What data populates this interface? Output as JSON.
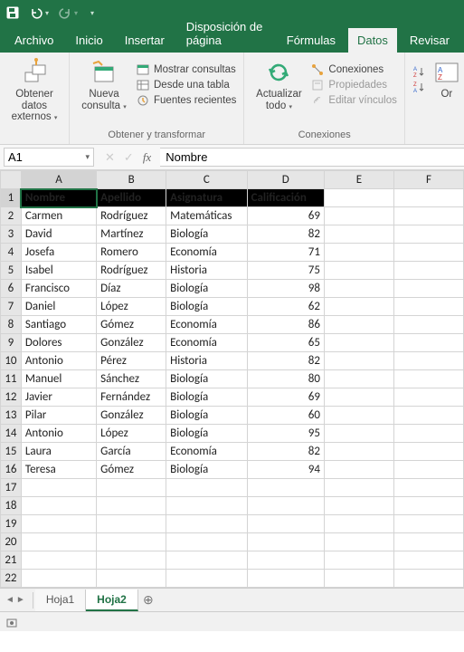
{
  "qat": {
    "save": "save-icon",
    "undo": "undo-icon",
    "redo": "redo-icon"
  },
  "menu_tabs": [
    "Archivo",
    "Inicio",
    "Insertar",
    "Disposición de página",
    "Fórmulas",
    "Datos",
    "Revisar"
  ],
  "active_menu_tab": "Datos",
  "ribbon": {
    "group1": {
      "btn_label_line1": "Obtener datos",
      "btn_label_line2": "externos",
      "label": ""
    },
    "group2": {
      "btn_label_line1": "Nueva",
      "btn_label_line2": "consulta",
      "items": [
        "Mostrar consultas",
        "Desde una tabla",
        "Fuentes recientes"
      ],
      "label": "Obtener y transformar"
    },
    "group3": {
      "btn_label_line1": "Actualizar",
      "btn_label_line2": "todo",
      "items": [
        "Conexiones",
        "Propiedades",
        "Editar vínculos"
      ],
      "label": "Conexiones"
    }
  },
  "namebox_value": "A1",
  "formula_value": "Nombre",
  "columns": [
    "A",
    "B",
    "C",
    "D",
    "E",
    "F"
  ],
  "row_count": 22,
  "headers": [
    "Nombre",
    "Apellido",
    "Asignatura",
    "Calificación"
  ],
  "rows": [
    [
      "Carmen",
      "Rodríguez",
      "Matemáticas",
      69
    ],
    [
      "David",
      "Martínez",
      "Biología",
      82
    ],
    [
      "Josefa",
      "Romero",
      "Economía",
      71
    ],
    [
      "Isabel",
      "Rodríguez",
      "Historia",
      75
    ],
    [
      "Francisco",
      "Díaz",
      "Biología",
      98
    ],
    [
      "Daniel",
      "López",
      "Biología",
      62
    ],
    [
      "Santiago",
      "Gómez",
      "Economía",
      86
    ],
    [
      "Dolores",
      "González",
      "Economía",
      65
    ],
    [
      "Antonio",
      "Pérez",
      "Historia",
      82
    ],
    [
      "Manuel",
      "Sánchez",
      "Biología",
      80
    ],
    [
      "Javier",
      "Fernández",
      "Biología",
      69
    ],
    [
      "Pilar",
      "González",
      "Biología",
      60
    ],
    [
      "Antonio",
      "López",
      "Biología",
      95
    ],
    [
      "Laura",
      "García",
      "Economía",
      82
    ],
    [
      "Teresa",
      "Gómez",
      "Biología",
      94
    ]
  ],
  "sheet_tabs": [
    "Hoja1",
    "Hoja2"
  ],
  "active_sheet": "Hoja2",
  "chart_data": {
    "type": "table",
    "title": "",
    "columns": [
      "Nombre",
      "Apellido",
      "Asignatura",
      "Calificación"
    ],
    "data": [
      [
        "Carmen",
        "Rodríguez",
        "Matemáticas",
        69
      ],
      [
        "David",
        "Martínez",
        "Biología",
        82
      ],
      [
        "Josefa",
        "Romero",
        "Economía",
        71
      ],
      [
        "Isabel",
        "Rodríguez",
        "Historia",
        75
      ],
      [
        "Francisco",
        "Díaz",
        "Biología",
        98
      ],
      [
        "Daniel",
        "López",
        "Biología",
        62
      ],
      [
        "Santiago",
        "Gómez",
        "Economía",
        86
      ],
      [
        "Dolores",
        "González",
        "Economía",
        65
      ],
      [
        "Antonio",
        "Pérez",
        "Historia",
        82
      ],
      [
        "Manuel",
        "Sánchez",
        "Biología",
        80
      ],
      [
        "Javier",
        "Fernández",
        "Biología",
        69
      ],
      [
        "Pilar",
        "González",
        "Biología",
        60
      ],
      [
        "Antonio",
        "López",
        "Biología",
        95
      ],
      [
        "Laura",
        "García",
        "Economía",
        82
      ],
      [
        "Teresa",
        "Gómez",
        "Biología",
        94
      ]
    ]
  }
}
